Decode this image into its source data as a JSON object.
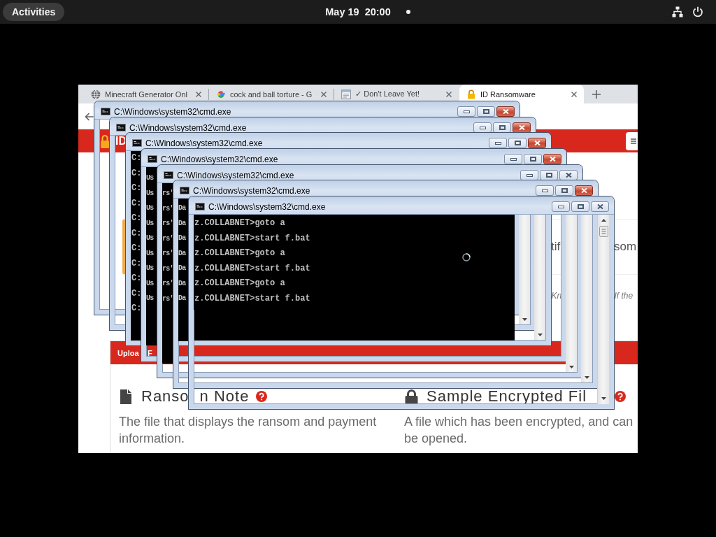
{
  "top_bar": {
    "activities": "Activities",
    "clock": "May 19  20:00"
  },
  "browser": {
    "tabs": [
      {
        "title": "Minecraft Generator Onl",
        "selected": false
      },
      {
        "title": "cock and ball torture - G",
        "selected": false
      },
      {
        "title": "✓ Don't Leave Yet!",
        "selected": false
      },
      {
        "title": "ID Ransomware",
        "selected": true
      }
    ],
    "header": {
      "logo_text": "ID"
    },
    "page": {
      "notice_fragments": [
        "tif",
        "som"
      ],
      "italic_fragments": [
        "Kn",
        "If the"
      ],
      "upload_panel": {
        "header_fragments": [
          "Uploa",
          "F"
        ],
        "columns": [
          {
            "title_parts": [
              "Ranso",
              "n Note"
            ],
            "description_lines": [
              "The file that displays the ransom and payment",
              "information."
            ]
          },
          {
            "title_parts": [
              "Sample Encrypted Fil"
            ],
            "description_lines": [
              "A file which has been encrypted, and can",
              "be opened."
            ]
          }
        ]
      }
    }
  },
  "windows": [
    {
      "title": "C:\\Windows\\system32\\cmd.exe",
      "highlighted": true
    },
    {
      "title": "C:\\Windows\\system32\\cmd.exe",
      "highlighted": true
    },
    {
      "title": "C:\\Windows\\system32\\cmd.exe",
      "highlighted": true,
      "lines": [
        "C:",
        "C:",
        "C:",
        "C:",
        "C:",
        "C:",
        "C:",
        "C:",
        "C:",
        "C:",
        "C:"
      ]
    },
    {
      "title": "C:\\Windows\\system32\\cmd.exe",
      "highlighted": true,
      "lines": [
        "Us",
        "Us",
        "Us",
        "Us",
        "Us",
        "Us",
        "Us",
        "Us",
        "Us"
      ]
    },
    {
      "title": "C:\\Windows\\system32\\cmd.exe",
      "highlighted": false,
      "lines": [
        "rs'",
        "rs'",
        "rs'",
        "rs'",
        "rs'",
        "rs'",
        "rs'",
        "rs'"
      ]
    },
    {
      "title": "C:\\Windows\\system32\\cmd.exe",
      "highlighted": true,
      "lines": [
        "Da",
        "Da",
        "Da",
        "Da",
        "Da",
        "Da",
        "Da"
      ]
    },
    {
      "title": "C:\\Windows\\system32\\cmd.exe",
      "highlighted": false,
      "lines": [
        "z.COLLABNET>goto a",
        "z.COLLABNET>start f.bat",
        "z.COLLABNET>goto a",
        "z.COLLABNET>start f.bat",
        "z.COLLABNET>goto a",
        "z.COLLABNET>start f.bat"
      ]
    }
  ]
}
